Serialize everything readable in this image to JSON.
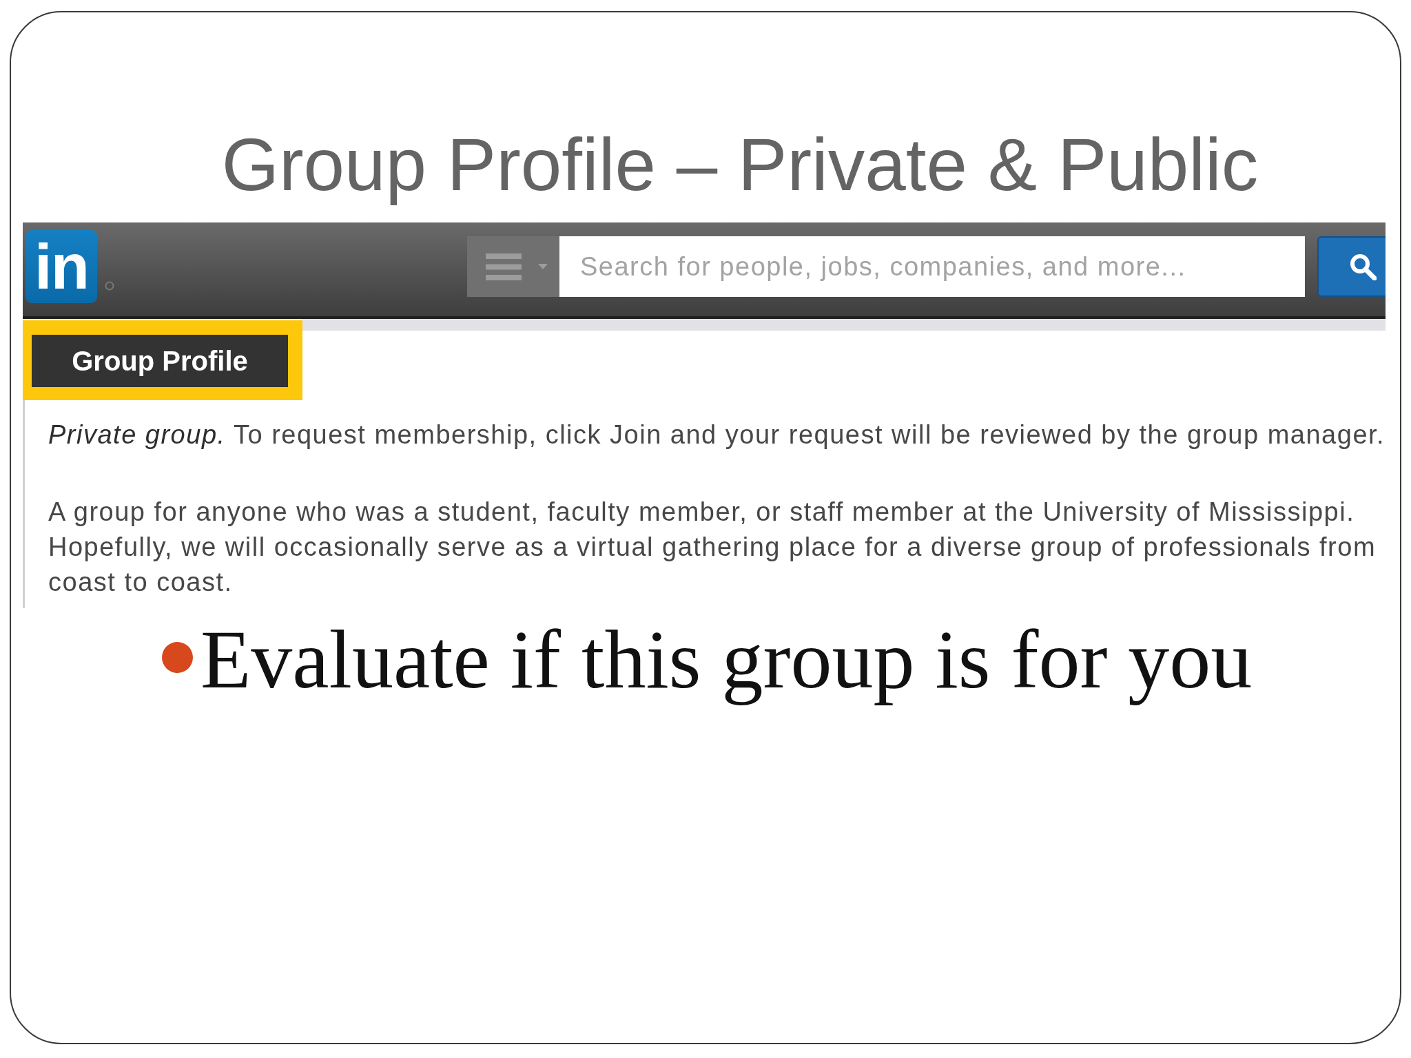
{
  "slide": {
    "title": "Group Profile – Private & Public"
  },
  "screenshot": {
    "logo": {
      "text": "in"
    },
    "search": {
      "placeholder": "Search for people, jobs, companies, and more..."
    },
    "section": {
      "heading": "Group Profile",
      "highlighted": true
    },
    "paragraphs": [
      "*Private group.* To request membership, click Join and your request will be reviewed by the group manager.",
      "A group for anyone who was a student, faculty member, or staff member at the University of Mississippi. Hopefully, we will occasionally serve as a virtual gathering place for a diverse group of professionals from coast to coast."
    ]
  },
  "bullets": [
    "Evaluate if this group is for you"
  ]
}
